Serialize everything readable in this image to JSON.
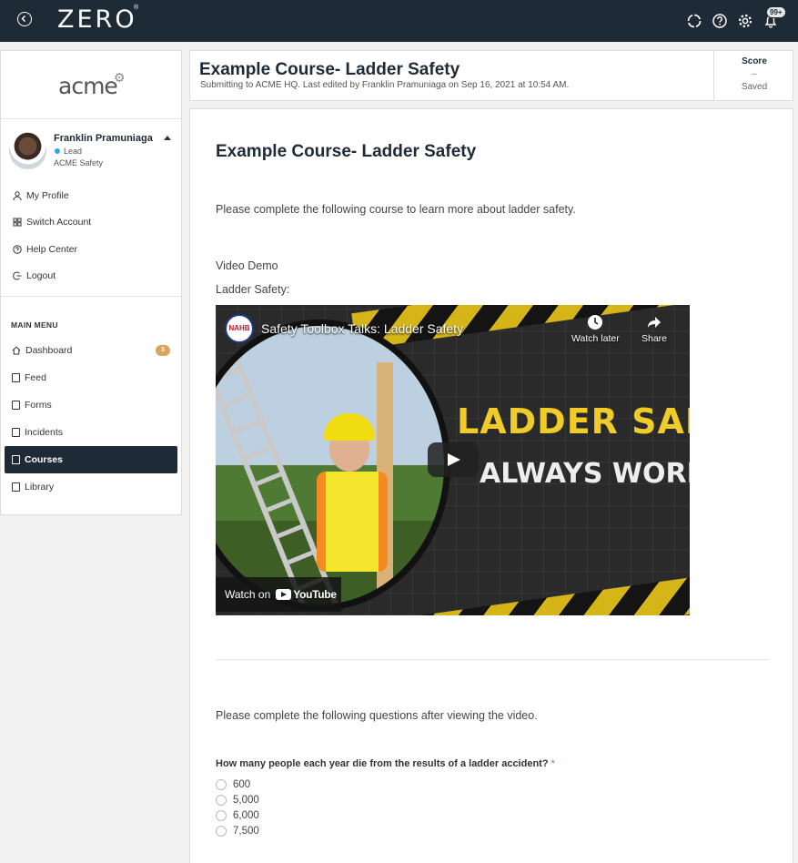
{
  "app": {
    "logo": "ZERO",
    "logo_mark": "®",
    "notification_count": "99+"
  },
  "sidebar": {
    "org_logo": "acme",
    "user": {
      "name": "Franklin Pramuniaga",
      "role": "Lead",
      "org": "ACME Safety"
    },
    "account_items": [
      {
        "label": "My Profile",
        "icon": "user-icon"
      },
      {
        "label": "Switch Account",
        "icon": "grid-icon"
      },
      {
        "label": "Help Center",
        "icon": "help-icon"
      },
      {
        "label": "Logout",
        "icon": "logout-icon"
      }
    ],
    "menu_header": "MAIN MENU",
    "menu_items": [
      {
        "label": "Dashboard",
        "icon": "home-icon",
        "badge": "3"
      },
      {
        "label": "Feed",
        "icon": "feed-icon"
      },
      {
        "label": "Forms",
        "icon": "forms-icon"
      },
      {
        "label": "Incidents",
        "icon": "incidents-icon"
      },
      {
        "label": "Courses",
        "icon": "courses-icon",
        "active": true
      },
      {
        "label": "Library",
        "icon": "library-icon"
      }
    ]
  },
  "header": {
    "title": "Example Course- Ladder Safety",
    "subtitle": "Submitting to ACME HQ. Last edited by Franklin Pramuniaga on Sep 16, 2021 at 10:54 AM.",
    "score_label": "Score",
    "score_value": "--",
    "score_status": "Saved"
  },
  "content": {
    "title": "Example Course- Ladder Safety",
    "intro": "Please complete the following course to learn more about ladder safety.",
    "video_demo_label": "Video Demo",
    "ladder_label": "Ladder Safety:",
    "video": {
      "channel": "NAHB",
      "title": "Safety Toolbox Talks: Ladder Safety",
      "watch_later": "Watch later",
      "share": "Share",
      "thumb_line1": "LADDER SAFETY",
      "thumb_line2": "ALWAYS WORK SAFE!",
      "watch_on": "Watch on",
      "youtube": "YouTube"
    },
    "questions_intro": "Please complete the following questions after viewing the video.",
    "question": {
      "label": "How many people each year die from the results of a ladder accident?",
      "required_mark": "*",
      "options": [
        "600",
        "5,000",
        "6,000",
        "7,500"
      ]
    }
  },
  "colors": {
    "topbar": "#1e2a36",
    "active_menu": "#1e2a36",
    "badge": "#d8a65a",
    "status_dot": "#2aa7e8"
  }
}
